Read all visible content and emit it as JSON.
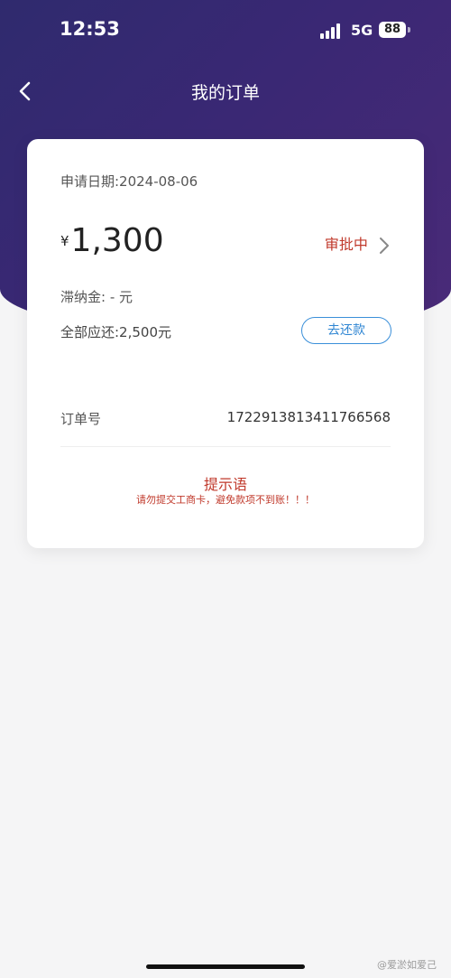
{
  "status_bar": {
    "time": "12:53",
    "network": "5G",
    "battery": "88"
  },
  "nav": {
    "title": "我的订单",
    "back_icon": "chevron-left-icon"
  },
  "order": {
    "apply_date": "申请日期:2024-08-06",
    "currency": "¥",
    "amount": "1,300",
    "status": "审批中",
    "late_fee": "滞纳金: - 元",
    "total_due": "全部应还:2,500元",
    "repay_button": "去还款",
    "order_no_label": "订单号",
    "order_no_value": "1722913813411766568"
  },
  "tip": {
    "title": "提示语",
    "text": "请勿提交工商卡，避免款项不到账！！！"
  },
  "watermark": "@爱淤如爱己",
  "colors": {
    "header": "#3a2874",
    "status_red": "#c0392b",
    "button_blue": "#2f86d3"
  }
}
